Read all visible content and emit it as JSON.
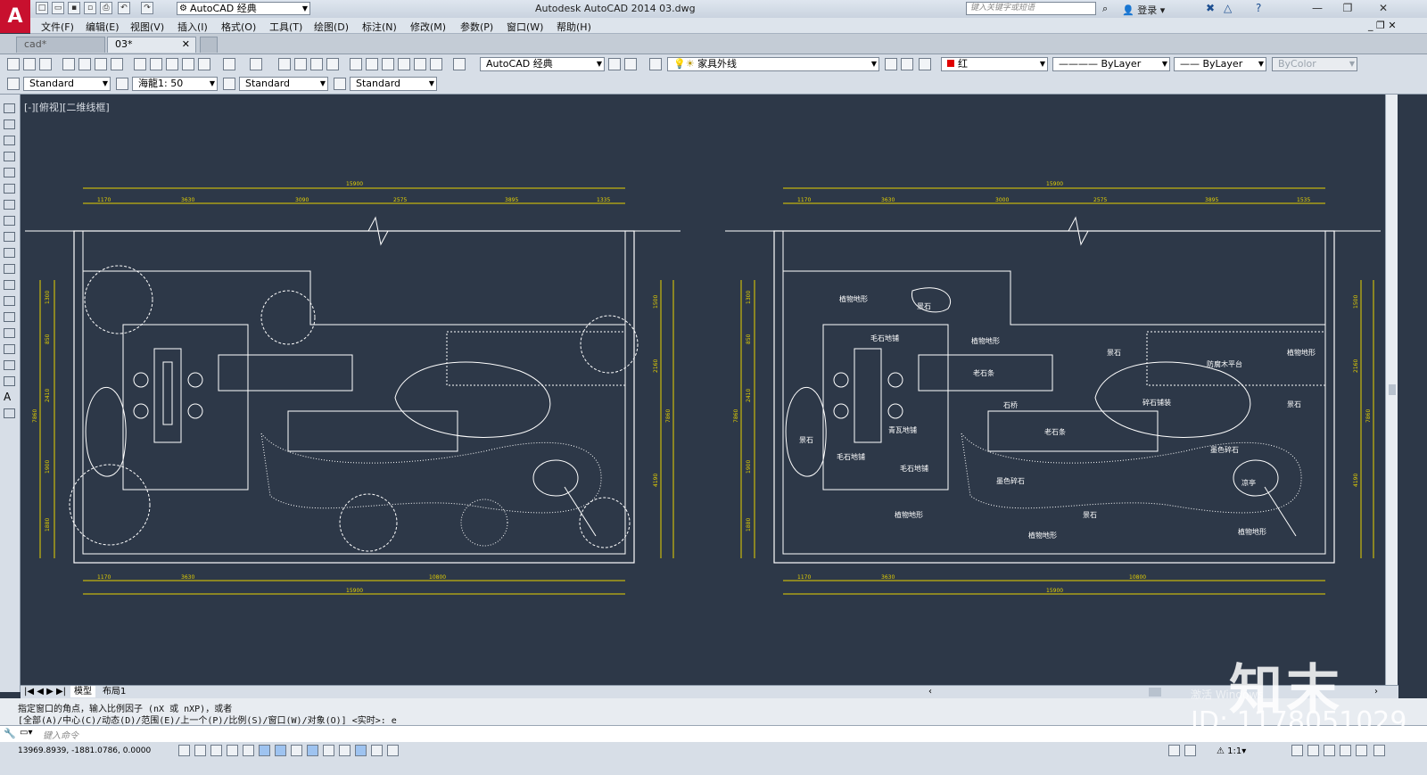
{
  "app": {
    "logo_letter": "A",
    "window_title": "Autodesk AutoCAD 2014    03.dwg",
    "workspace": "AutoCAD 经典",
    "search_placeholder": "键入关键字或短语",
    "login": "登录"
  },
  "menu": [
    "文件(F)",
    "编辑(E)",
    "视图(V)",
    "插入(I)",
    "格式(O)",
    "工具(T)",
    "绘图(D)",
    "标注(N)",
    "修改(M)",
    "参数(P)",
    "窗口(W)",
    "帮助(H)"
  ],
  "tabs": [
    {
      "label": "cad*",
      "active": false
    },
    {
      "label": "03*",
      "active": true
    }
  ],
  "toolbar1": {
    "workspace_combo": "AutoCAD 经典",
    "layer_combo": "家具外线",
    "color_combo": "红",
    "linetype_combo": "ByLayer",
    "lineweight_combo": "ByLayer",
    "plotstyle_combo": "ByColor"
  },
  "toolbar2": {
    "text_style": "Standard",
    "annotation_scale": "海龍1: 50",
    "dim_style": "Standard",
    "multileader_style": "Standard"
  },
  "viewport_label": "[-][俯视][二维线框]",
  "plan_left": {
    "dims_top": [
      "15900",
      "1170",
      "3630",
      "3090",
      "2575",
      "3895",
      "1335"
    ],
    "dims_left": [
      "1300",
      "850",
      "2410",
      "7860",
      "1900",
      "1880"
    ],
    "dims_right": [
      "1500",
      "2160",
      "7860",
      "4190"
    ],
    "dims_bottom": [
      "1170",
      "3630",
      "10800",
      "15900"
    ]
  },
  "plan_right": {
    "dims_top": [
      "15900",
      "1170",
      "3630",
      "3000",
      "2575",
      "3895",
      "1535"
    ],
    "dims_left": [
      "1300",
      "850",
      "2410",
      "7860",
      "1900",
      "1880"
    ],
    "dims_right": [
      "1500",
      "2160",
      "7860",
      "4190"
    ],
    "dims_bottom": [
      "1170",
      "3630",
      "10800",
      "15900"
    ],
    "labels": [
      "植物地形",
      "景石",
      "毛石地铺",
      "植物地形",
      "景石",
      "老石条",
      "防腐木平台",
      "植物地形",
      "石桥",
      "碎石铺装",
      "景石",
      "青瓦地铺",
      "老石条",
      "墨色碎石",
      "景石",
      "毛石地铺",
      "毛石地铺",
      "墨色碎石",
      "凉亭",
      "植物地形",
      "景石",
      "植物地形",
      "植物地形"
    ]
  },
  "layout_tabs": [
    "模型",
    "布局1"
  ],
  "command_history": [
    "指定窗口的角点，输入比例因子 (nX 或 nXP)，或者",
    "[全部(A)/中心(C)/动态(D)/范围(E)/上一个(P)/比例(S)/窗口(W)/对象(O)] <实时>: e"
  ],
  "command_placeholder": "键入命令",
  "coordinates": "13969.8939, -1881.0786, 0.0000",
  "status_scale": "1:1",
  "watermark": {
    "brand": "知末",
    "id": "ID: 1178051029",
    "activate": "激活 Windows"
  },
  "colors": {
    "canvas": "#2d3848",
    "dimension": "#e6d200",
    "linework": "#ffffff",
    "layer_color": "#e00000"
  }
}
